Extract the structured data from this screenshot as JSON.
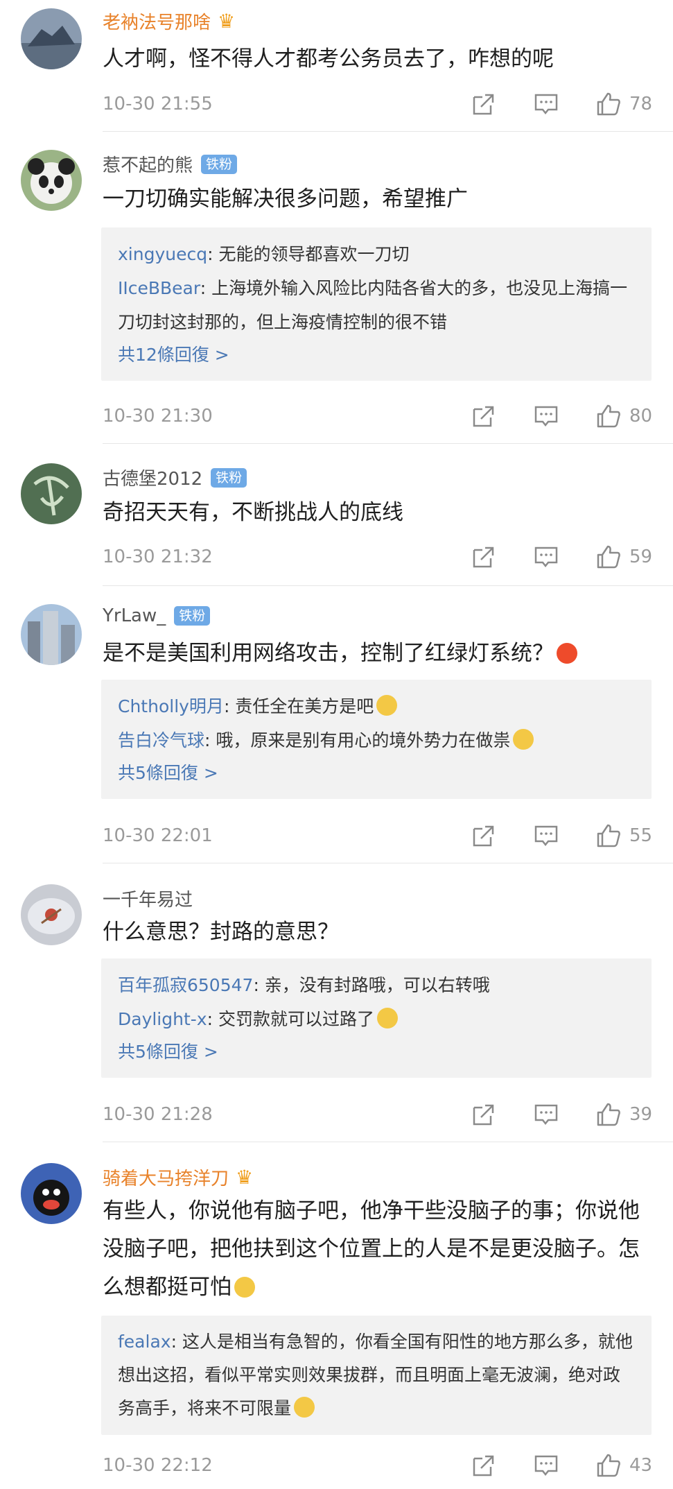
{
  "comments": [
    {
      "username": "老衲法号那啥",
      "vip": true,
      "badge": "",
      "content": "人才啊，怪不得人才都考公务员去了，咋想的呢",
      "replies": [],
      "more": "",
      "time": "10-30 21:55",
      "likes": "78"
    },
    {
      "username": "惹不起的熊",
      "vip": false,
      "badge": "铁粉",
      "content": "一刀切确实能解决很多问题，希望推广",
      "replies": [
        {
          "user": "xingyuecq",
          "text": ": 无能的领导都喜欢一刀切"
        },
        {
          "user": "IIceBBear",
          "text": ": 上海境外输入风险比内陆各省大的多，也没见上海搞一刀切封这封那的，但上海疫情控制的很不错"
        }
      ],
      "more": "共12條回復 >",
      "time": "10-30 21:30",
      "likes": "80"
    },
    {
      "username": "古德堡2012",
      "vip": false,
      "badge": "铁粉",
      "content": "奇招天天有，不断挑战人的底线",
      "replies": [],
      "more": "",
      "time": "10-30 21:32",
      "likes": "59"
    },
    {
      "username": "YrLaw_",
      "vip": false,
      "badge": "铁粉",
      "content": "是不是美国利用网络攻击，控制了红绿灯系统？",
      "replies": [
        {
          "user": "Chtholly明月",
          "text": ": 责任全在美方是吧"
        },
        {
          "user": "告白冷气球",
          "text": ": 哦，原来是别有用心的境外势力在做祟"
        }
      ],
      "more": "共5條回復 >",
      "time": "10-30 22:01",
      "likes": "55"
    },
    {
      "username": "一千年易过",
      "vip": false,
      "badge": "",
      "content": "什么意思？封路的意思？",
      "replies": [
        {
          "user": "百年孤寂650547",
          "text": ": 亲，没有封路哦，可以右转哦"
        },
        {
          "user": "Daylight-x",
          "text": ": 交罚款就可以过路了"
        }
      ],
      "more": "共5條回復 >",
      "time": "10-30 21:28",
      "likes": "39"
    },
    {
      "username": "骑着大马挎洋刀",
      "vip": true,
      "badge": "",
      "content": "有些人，你说他有脑子吧，他净干些没脑子的事；你说他没脑子吧，把他扶到这个位置上的人是不是更没脑子。怎么想都挺可怕",
      "replies": [
        {
          "user": "fealax",
          "text": ": 这人是相当有急智的，你看全国有阳性的地方那么多，就他想出这招，看似平常实则效果拔群，而且明面上毫无波澜，绝对政务高手，将来不可限量"
        }
      ],
      "more": "",
      "time": "10-30 22:12",
      "likes": "43"
    }
  ],
  "icons": {
    "share": "share-icon",
    "reply": "comment-icon",
    "like": "thumbs-up-icon",
    "vip": "crown-icon"
  },
  "colors": {
    "vip_name": "#e8822a",
    "reply_user": "#4a78b5",
    "badge": "#6ea9e6",
    "reply_bg": "#f2f2f2"
  }
}
